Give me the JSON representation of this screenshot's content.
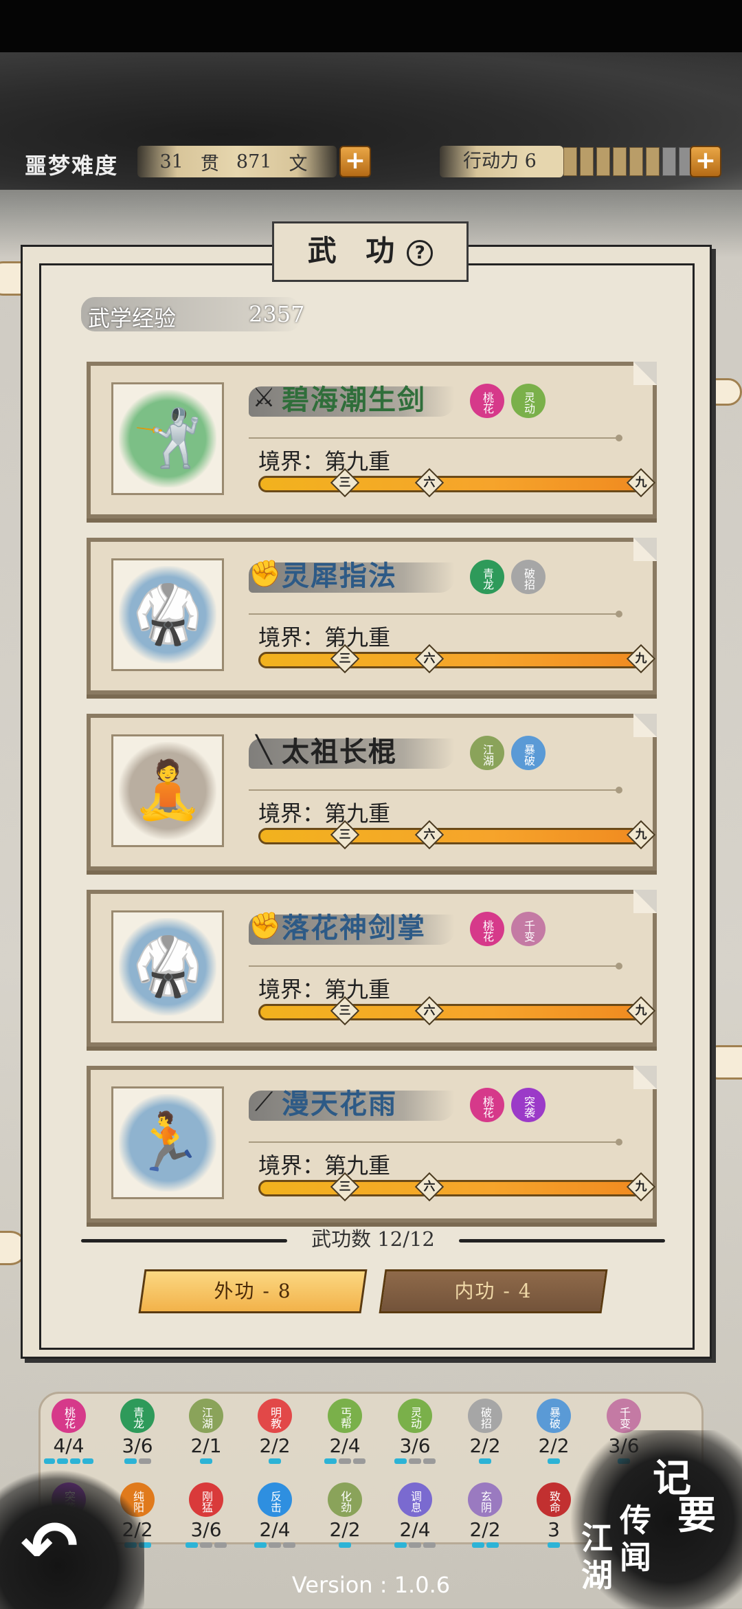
{
  "header": {
    "difficulty": "噩梦难度",
    "money": {
      "guan": "31",
      "guan_unit": "贯",
      "wen": "871",
      "wen_unit": "文"
    },
    "action_label": "行动力 6",
    "action_filled": 6,
    "action_total": 8,
    "plus": "+"
  },
  "panel": {
    "title": "武 功",
    "help": "?",
    "exp_label": "武学经验",
    "exp_value": "2357"
  },
  "skills": [
    {
      "name": "碧海潮生剑",
      "weapon_icon": "sword-icon",
      "portrait": "swordsman-silhouette",
      "portrait_color": "#7cbf86",
      "name_color": "#2f6e3a",
      "tags": [
        {
          "text": "桃花",
          "color": "#d6398a"
        },
        {
          "text": "灵动",
          "color": "#7ab04a"
        }
      ],
      "realm": "境界：第九重",
      "marks": [
        "三",
        "六",
        "九"
      ],
      "progress": 1.0
    },
    {
      "name": "灵犀指法",
      "weapon_icon": "fist-icon",
      "portrait": "fighter-silhouette",
      "portrait_color": "#8fb3cf",
      "name_color": "#2d5a86",
      "tags": [
        {
          "text": "青龙",
          "color": "#2e9a5a"
        },
        {
          "text": "破招",
          "color": "#a6a6a6"
        }
      ],
      "realm": "境界：第九重",
      "marks": [
        "三",
        "六",
        "九"
      ],
      "progress": 1.0
    },
    {
      "name": "太祖长棍",
      "weapon_icon": "staff-icon",
      "portrait": "staff-silhouette",
      "portrait_color": "#b9aea0",
      "name_color": "#222222",
      "tags": [
        {
          "text": "江湖",
          "color": "#8aa35a"
        },
        {
          "text": "暴破",
          "color": "#5a9ad6"
        }
      ],
      "realm": "境界：第九重",
      "marks": [
        "三",
        "六",
        "九"
      ],
      "progress": 1.0
    },
    {
      "name": "落花神剑掌",
      "weapon_icon": "fist-icon",
      "portrait": "fighter-silhouette",
      "portrait_color": "#8fb3cf",
      "name_color": "#2d5a86",
      "tags": [
        {
          "text": "桃花",
          "color": "#d6398a"
        },
        {
          "text": "千变",
          "color": "#c47aa4"
        }
      ],
      "realm": "境界：第九重",
      "marks": [
        "三",
        "六",
        "九"
      ],
      "progress": 1.0
    },
    {
      "name": "漫天花雨",
      "weapon_icon": "dart-icon",
      "portrait": "thrower-silhouette",
      "portrait_color": "#8fb3cf",
      "name_color": "#2d5a86",
      "tags": [
        {
          "text": "桃花",
          "color": "#d6398a"
        },
        {
          "text": "突袭",
          "color": "#9b3ac8"
        }
      ],
      "realm": "境界：第九重",
      "marks": [
        "三",
        "六",
        "九"
      ],
      "progress": 1.0
    }
  ],
  "skill_count": "武功数 12/12",
  "tabs": [
    {
      "label": "外功 - 8",
      "active": true
    },
    {
      "label": "内功 - 4",
      "active": false
    }
  ],
  "tag_stats": [
    {
      "text": "桃花",
      "color": "#d6398a",
      "count": "4/4",
      "on": 4,
      "total": 4
    },
    {
      "text": "青龙",
      "color": "#2e9a5a",
      "count": "3/6",
      "on": 1,
      "total": 2
    },
    {
      "text": "江湖",
      "color": "#8aa35a",
      "count": "2/1",
      "on": 1,
      "total": 1
    },
    {
      "text": "明教",
      "color": "#e24848",
      "count": "2/2",
      "on": 1,
      "total": 1
    },
    {
      "text": "丐帮",
      "color": "#7ab04a",
      "count": "2/4",
      "on": 1,
      "total": 3
    },
    {
      "text": "灵动",
      "color": "#7ab04a",
      "count": "3/6",
      "on": 1,
      "total": 3
    },
    {
      "text": "破招",
      "color": "#a6a6a6",
      "count": "2/2",
      "on": 1,
      "total": 1
    },
    {
      "text": "暴破",
      "color": "#5a9ad6",
      "count": "2/2",
      "on": 1,
      "total": 1
    },
    {
      "text": "千变",
      "color": "#c47aa4",
      "count": "3/6",
      "on": 1,
      "total": 1
    },
    {
      "text": "突袭",
      "color": "#9b3ac8",
      "count": "",
      "on": 0,
      "total": 0
    },
    {
      "text": "纯阳",
      "color": "#e07a1c",
      "count": "2/2",
      "on": 2,
      "total": 2
    },
    {
      "text": "刚猛",
      "color": "#d93a3a",
      "count": "3/6",
      "on": 1,
      "total": 3
    },
    {
      "text": "反击",
      "color": "#2e8fe0",
      "count": "2/4",
      "on": 1,
      "total": 3
    },
    {
      "text": "化劲",
      "color": "#8aa35a",
      "count": "2/2",
      "on": 1,
      "total": 1
    },
    {
      "text": "调息",
      "color": "#7a6ad0",
      "count": "2/4",
      "on": 1,
      "total": 3
    },
    {
      "text": "玄阴",
      "color": "#9a7ac0",
      "count": "2/2",
      "on": 2,
      "total": 2
    },
    {
      "text": "致命",
      "color": "#c23030",
      "count": "3",
      "on": 1,
      "total": 1
    }
  ],
  "bottom": {
    "back": "↶",
    "journal": [
      "记",
      "要"
    ],
    "news": [
      "江",
      "传",
      "湖",
      "闻"
    ],
    "version": "Version : 1.0.6"
  }
}
